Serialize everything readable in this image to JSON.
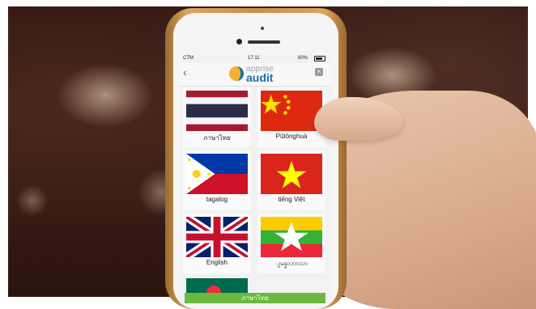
{
  "status": {
    "carrier": "CTM",
    "time": "17:11",
    "battery": "60%"
  },
  "header": {
    "logo_top": "apprise",
    "logo_bottom": "audit"
  },
  "languages": [
    {
      "label": "ภาษาไทย",
      "flag": "thailand-flag"
    },
    {
      "label": "Pǔtōnghuà",
      "flag": "china-flag"
    },
    {
      "label": "tagalog",
      "flag": "philippines-flag"
    },
    {
      "label": "tiếng Việt",
      "flag": "vietnam-flag"
    },
    {
      "label": "English",
      "flag": "uk-flag"
    },
    {
      "label": "ျမန္မာဘာသာ",
      "flag": "myanmar-flag"
    }
  ],
  "bottom_button": "ภาษาไทย",
  "colors": {
    "brand_blue": "#1a6fb0",
    "accent_green": "#6ab93e"
  }
}
